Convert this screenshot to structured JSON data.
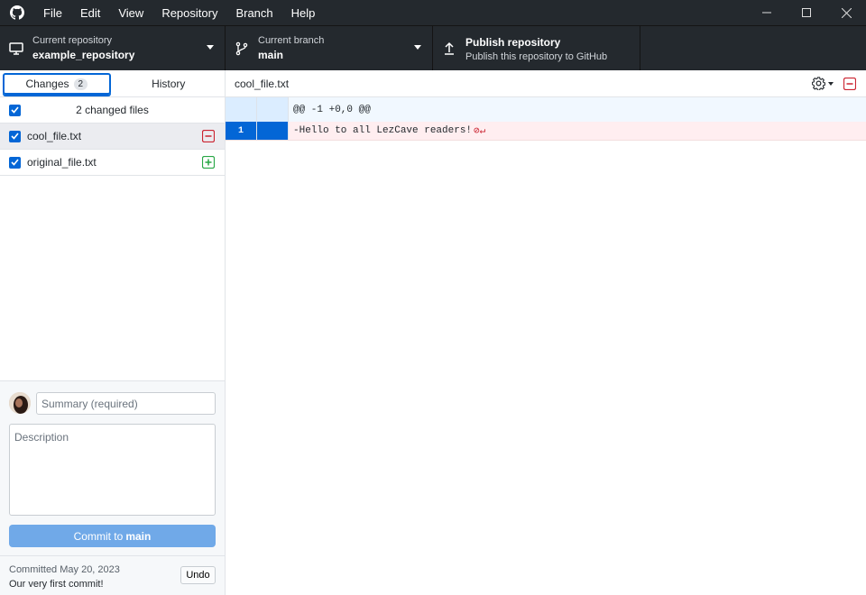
{
  "menu": [
    "File",
    "Edit",
    "View",
    "Repository",
    "Branch",
    "Help"
  ],
  "toolbar": {
    "repo_sub": "Current repository",
    "repo_name": "example_repository",
    "branch_sub": "Current branch",
    "branch_name": "main",
    "publish_title": "Publish repository",
    "publish_sub": "Publish this repository to GitHub"
  },
  "tabs": {
    "changes": "Changes",
    "changes_count": "2",
    "history": "History"
  },
  "changes": {
    "header": "2 changed files",
    "files": [
      {
        "name": "cool_file.txt",
        "status": "deleted"
      },
      {
        "name": "original_file.txt",
        "status": "added"
      }
    ]
  },
  "commit": {
    "summary_placeholder": "Summary (required)",
    "description_placeholder": "Description",
    "button_prefix": "Commit to",
    "button_branch": "main"
  },
  "last_commit": {
    "date_line": "Committed May 20, 2023",
    "message": "Our very first commit!",
    "undo": "Undo"
  },
  "diff": {
    "file": "cool_file.txt",
    "hunk": "@@ -1 +0,0 @@",
    "lines": [
      {
        "old_no": "1",
        "text": "-Hello to all LezCave readers!"
      }
    ]
  },
  "colors": {
    "accent": "#0366d6",
    "deleted": "#cb2431",
    "added": "#28a745",
    "dark": "#24292e"
  }
}
